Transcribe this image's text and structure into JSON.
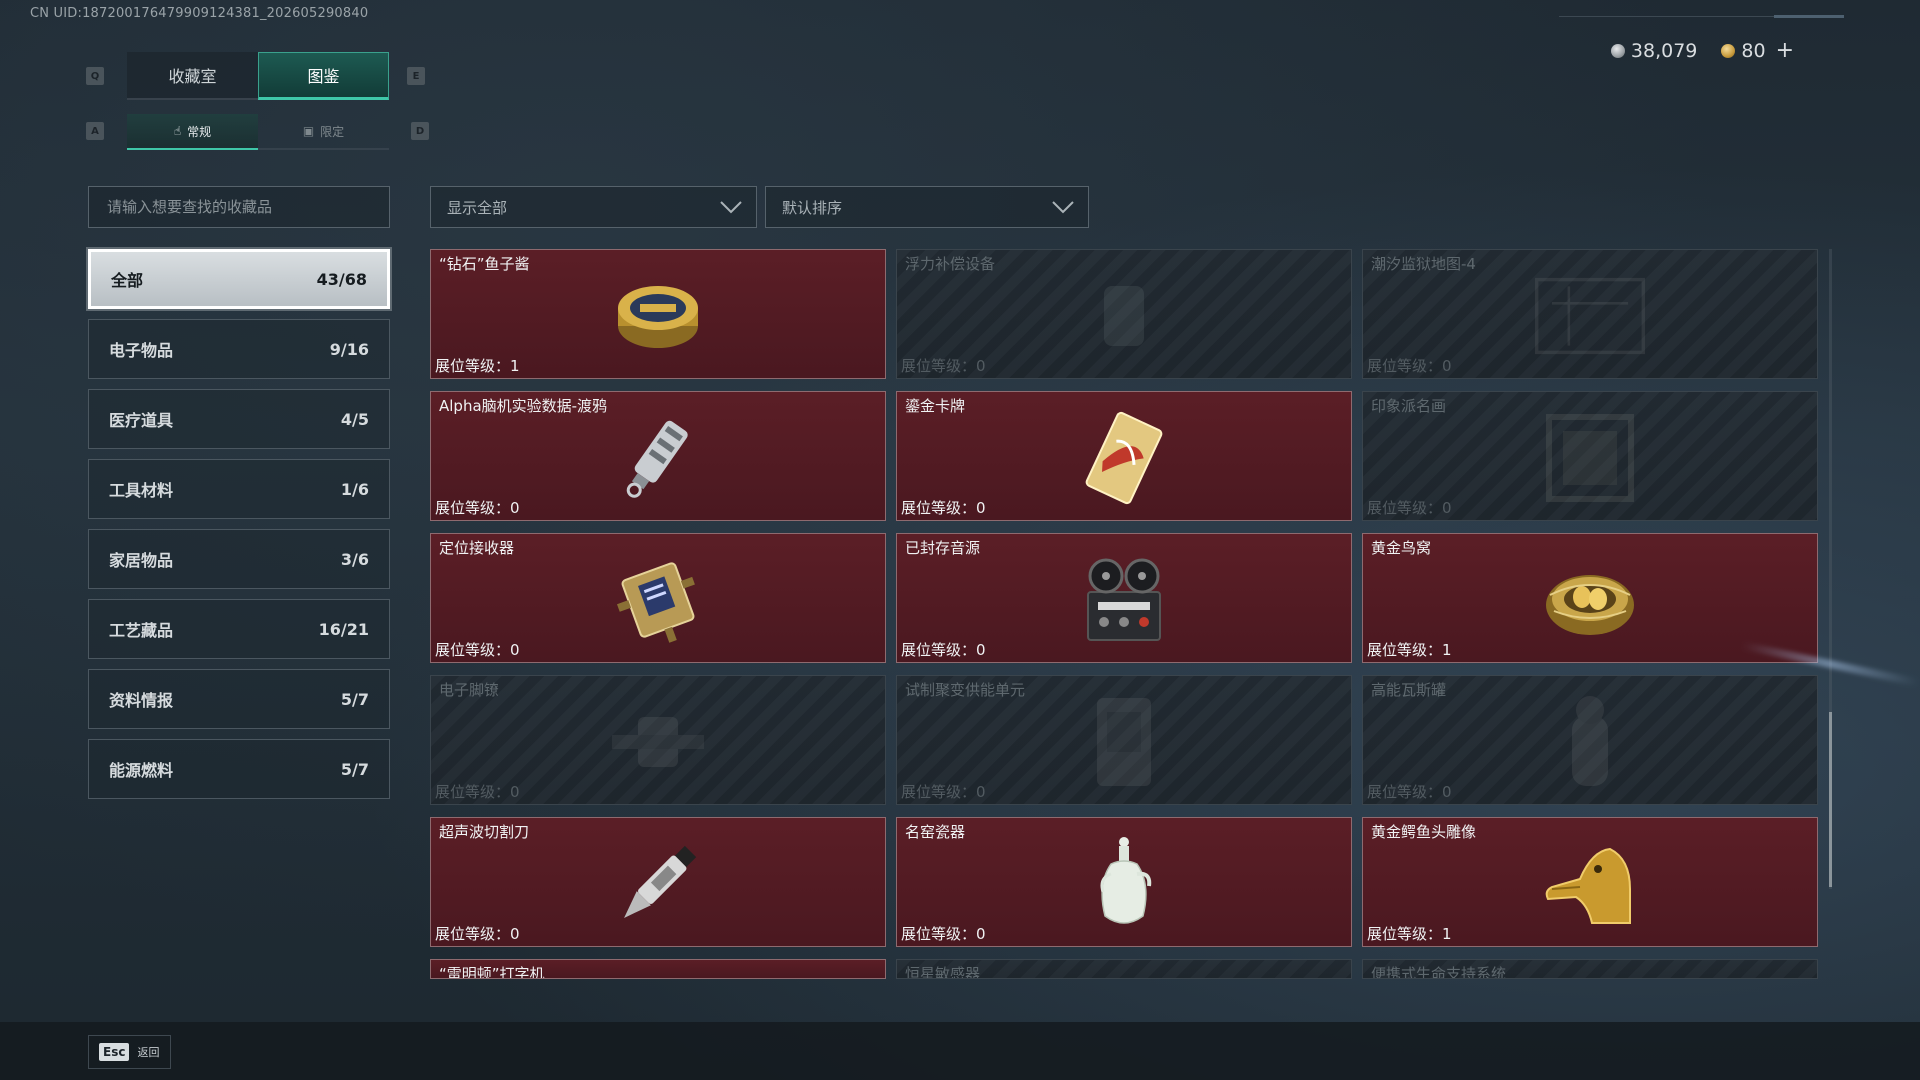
{
  "header": {
    "uid": "CN UID:18720017647990912438​1_202605290840",
    "currency": [
      {
        "value": "38,079",
        "icon": "silver-coin-icon"
      },
      {
        "value": "80",
        "icon": "gold-coin-icon"
      }
    ],
    "add_symbol": "+"
  },
  "keys": {
    "prev_tab": "Q",
    "next_tab": "E",
    "prev_sub": "A",
    "next_sub": "D"
  },
  "tabs": [
    {
      "label": "收藏室",
      "active": false
    },
    {
      "label": "图鉴",
      "active": true
    }
  ],
  "subtabs": [
    {
      "label": "常规",
      "icon": "hand-icon",
      "active": true
    },
    {
      "label": "限定",
      "icon": "image-icon",
      "active": false
    }
  ],
  "search": {
    "placeholder": "请输入想要查找的收藏品"
  },
  "filters": {
    "display": "显示全部",
    "sort": "默认排序"
  },
  "categories": [
    {
      "label": "全部",
      "count": "43/68",
      "active": true
    },
    {
      "label": "电子物品",
      "count": "9/16"
    },
    {
      "label": "医疗道具",
      "count": "4/5"
    },
    {
      "label": "工具材料",
      "count": "1/6"
    },
    {
      "label": "家居物品",
      "count": "3/6"
    },
    {
      "label": "工艺藏品",
      "count": "16/21"
    },
    {
      "label": "资料情报",
      "count": "5/7"
    },
    {
      "label": "能源燃料",
      "count": "5/7"
    }
  ],
  "items": [
    {
      "name": "“钻石”鱼子酱",
      "level": "展位等级：1",
      "owned": true,
      "icon": "caviar-tin-icon"
    },
    {
      "name": "浮力补偿设备",
      "level": "展位等级：0",
      "owned": false,
      "icon": "buoyancy-device-icon"
    },
    {
      "name": "潮汐监狱地图-4",
      "level": "展位等级：0",
      "owned": false,
      "icon": "map-icon"
    },
    {
      "name": "Alpha脑机实验数据-渡鸦",
      "level": "展位等级：0",
      "owned": true,
      "icon": "data-drive-icon"
    },
    {
      "name": "鎏金卡牌",
      "level": "展位等级：0",
      "owned": true,
      "icon": "gold-card-icon"
    },
    {
      "name": "印象派名画",
      "level": "展位等级：0",
      "owned": false,
      "icon": "painting-icon"
    },
    {
      "name": "定位接收器",
      "level": "展位等级：0",
      "owned": true,
      "icon": "receiver-icon"
    },
    {
      "name": "已封存音源",
      "level": "展位等级：0",
      "owned": true,
      "icon": "reel-recorder-icon"
    },
    {
      "name": "黄金鸟窝",
      "level": "展位等级：1",
      "owned": true,
      "icon": "golden-nest-icon"
    },
    {
      "name": "电子脚镣",
      "level": "展位等级：0",
      "owned": false,
      "icon": "ankle-monitor-icon"
    },
    {
      "name": "试制聚变供能单元",
      "level": "展位等级：0",
      "owned": false,
      "icon": "fusion-unit-icon"
    },
    {
      "name": "高能瓦斯罐",
      "level": "展位等级：0",
      "owned": false,
      "icon": "gas-canister-icon"
    },
    {
      "name": "超声波切割刀",
      "level": "展位等级：0",
      "owned": true,
      "icon": "ultrasonic-cutter-icon"
    },
    {
      "name": "名窑瓷器",
      "level": "展位等级：0",
      "owned": true,
      "icon": "porcelain-vase-icon"
    },
    {
      "name": "黄金鳄鱼头雕像",
      "level": "展位等级：1",
      "owned": true,
      "icon": "golden-crocodile-icon"
    },
    {
      "name": "“雷明顿”打字机",
      "level": "",
      "owned": true,
      "icon": "typewriter-icon"
    },
    {
      "name": "恒星敏感器",
      "level": "",
      "owned": false,
      "icon": "star-sensor-icon"
    },
    {
      "name": "便携式生命支持系统",
      "level": "",
      "owned": false,
      "icon": "life-support-icon"
    }
  ],
  "footer": {
    "esc_key": "Esc",
    "back_label": "返回"
  }
}
